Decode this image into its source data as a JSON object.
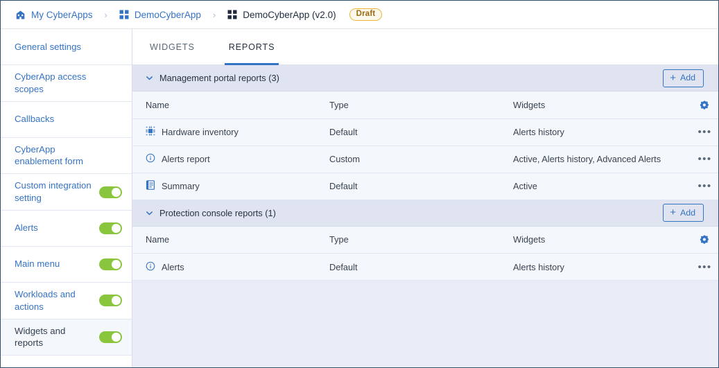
{
  "breadcrumb": {
    "items": [
      {
        "label": "My CyberApps",
        "icon": "home-icon",
        "current": false
      },
      {
        "label": "DemoCyberApp",
        "icon": "grid-icon",
        "current": false
      },
      {
        "label": "DemoCyberApp (v2.0)",
        "icon": "grid-icon",
        "current": true
      }
    ],
    "separator": "›",
    "badge": "Draft"
  },
  "sidebar": {
    "items": [
      {
        "label": "General settings",
        "toggle": null,
        "selected": false
      },
      {
        "label": "CyberApp access scopes",
        "toggle": null,
        "selected": false
      },
      {
        "label": "Callbacks",
        "toggle": null,
        "selected": false
      },
      {
        "label": "CyberApp enablement form",
        "toggle": null,
        "selected": false
      },
      {
        "label": "Custom integration setting",
        "toggle": "on",
        "selected": false
      },
      {
        "label": "Alerts",
        "toggle": "on",
        "selected": false
      },
      {
        "label": "Main menu",
        "toggle": "on",
        "selected": false
      },
      {
        "label": "Workloads and actions",
        "toggle": "on",
        "selected": false
      },
      {
        "label": "Widgets and reports",
        "toggle": "on",
        "selected": true
      }
    ]
  },
  "tabs": [
    {
      "label": "WIDGETS",
      "active": false
    },
    {
      "label": "REPORTS",
      "active": true
    }
  ],
  "sections": [
    {
      "title": "Management portal reports (3)",
      "add_label": "Add",
      "columns": {
        "name": "Name",
        "type": "Type",
        "widgets": "Widgets"
      },
      "rows": [
        {
          "icon": "chip-icon",
          "name": "Hardware inventory",
          "type": "Default",
          "widgets": "Alerts history",
          "menu": "•••"
        },
        {
          "icon": "info-circle-icon",
          "name": "Alerts report",
          "type": "Custom",
          "widgets": "Active, Alerts history, Advanced Alerts",
          "menu": "•••"
        },
        {
          "icon": "document-icon",
          "name": "Summary",
          "type": "Default",
          "widgets": "Active",
          "menu": "•••"
        }
      ]
    },
    {
      "title": "Protection console reports (1)",
      "add_label": "Add",
      "columns": {
        "name": "Name",
        "type": "Type",
        "widgets": "Widgets"
      },
      "rows": [
        {
          "icon": "info-circle-icon",
          "name": "Alerts",
          "type": "Default",
          "widgets": "Alerts history",
          "menu": "•••"
        }
      ]
    }
  ],
  "colors": {
    "link_blue": "#3573c4",
    "toggle_green": "#8ac53e",
    "draft_amber": "#e8b53a",
    "section_header_bg": "#dfe4f0",
    "panel_bg": "#e9edf8"
  }
}
